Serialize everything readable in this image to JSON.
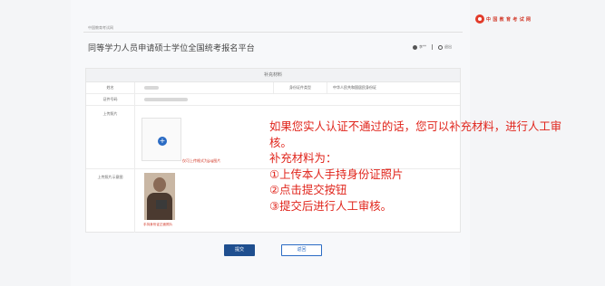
{
  "breadcrumb": "中国教育考试网",
  "header": {
    "title": "同等学力人员申请硕士学位全国统考报名平台",
    "user_name": "李**",
    "exit_label": "退出"
  },
  "logo": {
    "text": "中 国 教 育 考 试 网"
  },
  "form": {
    "section_title": "补充材料",
    "name_label": "姓名",
    "id_type_label": "身份证件类型",
    "id_type_value": "中华人民共和国居民身份证",
    "id_number_label": "证件号码",
    "upload_label": "上传照片",
    "upload_hint": "仅可上传格式为jpg图片",
    "sample_label": "上传照片示意图",
    "sample_caption": "手持身份证正面照片"
  },
  "annotation": {
    "lines": [
      "如果您实人认证不通过的话，您可以补充材料，进行人工审",
      "核。",
      "补充材料为：",
      "①上传本人手持身份证照片",
      "②点击提交按钮",
      "③提交后进行人工审核。"
    ]
  },
  "buttons": {
    "submit": "提交",
    "back": "返回"
  },
  "colors": {
    "primary": "#1f4f8f",
    "accent_red": "#e0241b",
    "link_blue": "#2a6bc4"
  }
}
